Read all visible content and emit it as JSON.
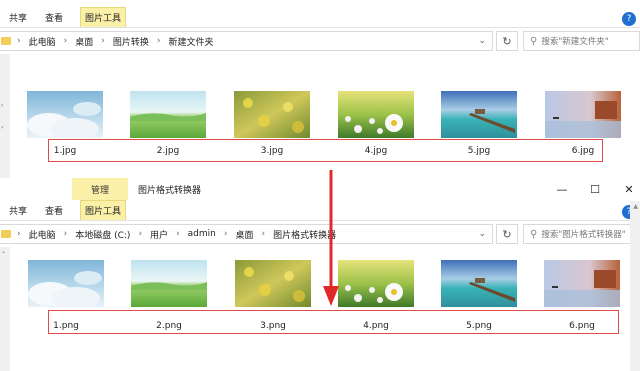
{
  "top_window": {
    "tabs": [
      "共享",
      "查看",
      "图片工具"
    ],
    "active_tab": "图片工具",
    "breadcrumb": [
      "此电脑",
      "桌面",
      "图片转换",
      "新建文件夹"
    ],
    "search_placeholder": "搜索\"新建文件夹\"",
    "files": [
      "1.jpg",
      "2.jpg",
      "3.jpg",
      "4.jpg",
      "5.jpg",
      "6.jpg"
    ]
  },
  "bottom_window": {
    "manage_tab": "管理",
    "title": "图片格式转换器",
    "tabs": [
      "共享",
      "查看",
      "图片工具"
    ],
    "active_tab": "图片工具",
    "breadcrumb": [
      "此电脑",
      "本地磁盘 (C:)",
      "用户",
      "admin",
      "桌面",
      "图片格式转换器"
    ],
    "search_placeholder": "搜索\"图片格式转换器\"",
    "files": [
      "1.png",
      "2.png",
      "3.png",
      "4.png",
      "5.png",
      "6.png"
    ]
  },
  "icons": {
    "refresh": "refresh-icon",
    "search": "search-icon",
    "minimize": "minimize-icon",
    "maximize": "maximize-icon",
    "close": "close-icon",
    "help": "help-icon"
  },
  "colors": {
    "highlight_tab": "#fbf0a8",
    "annotation_red": "#e24a4a",
    "folder_yellow": "#f3cd5a"
  }
}
